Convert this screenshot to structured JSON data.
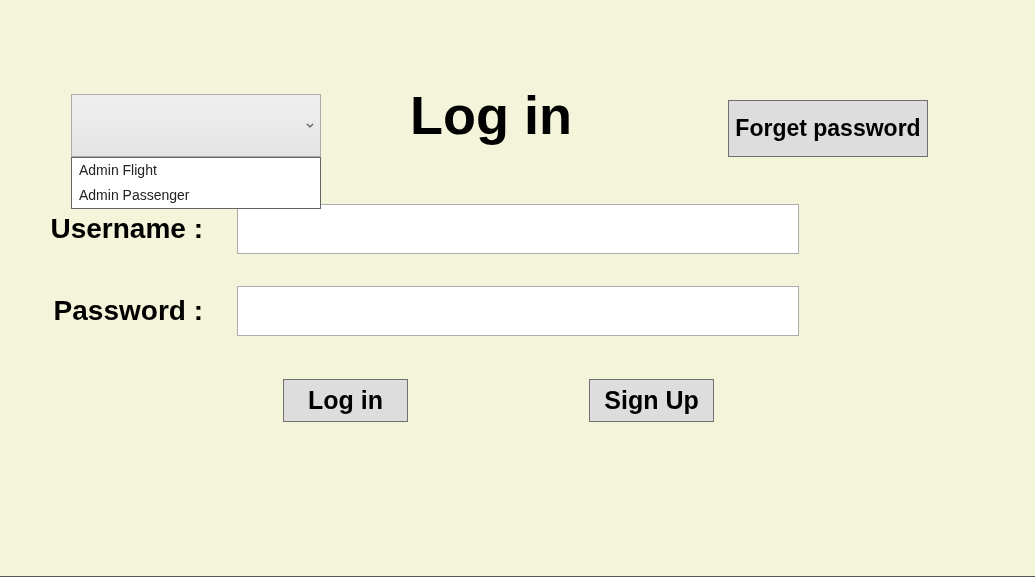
{
  "dropdown": {
    "expanded": true,
    "options": [
      {
        "label": "Admin Flight",
        "selected": false
      },
      {
        "label": "Admin Passenger",
        "selected": false
      }
    ]
  },
  "title": "Log in",
  "forget_password_button": "Forget password",
  "fields": [
    {
      "label": "Username :"
    },
    {
      "label": "Password :"
    }
  ],
  "buttons": [
    "Log in",
    "Sign Up"
  ]
}
